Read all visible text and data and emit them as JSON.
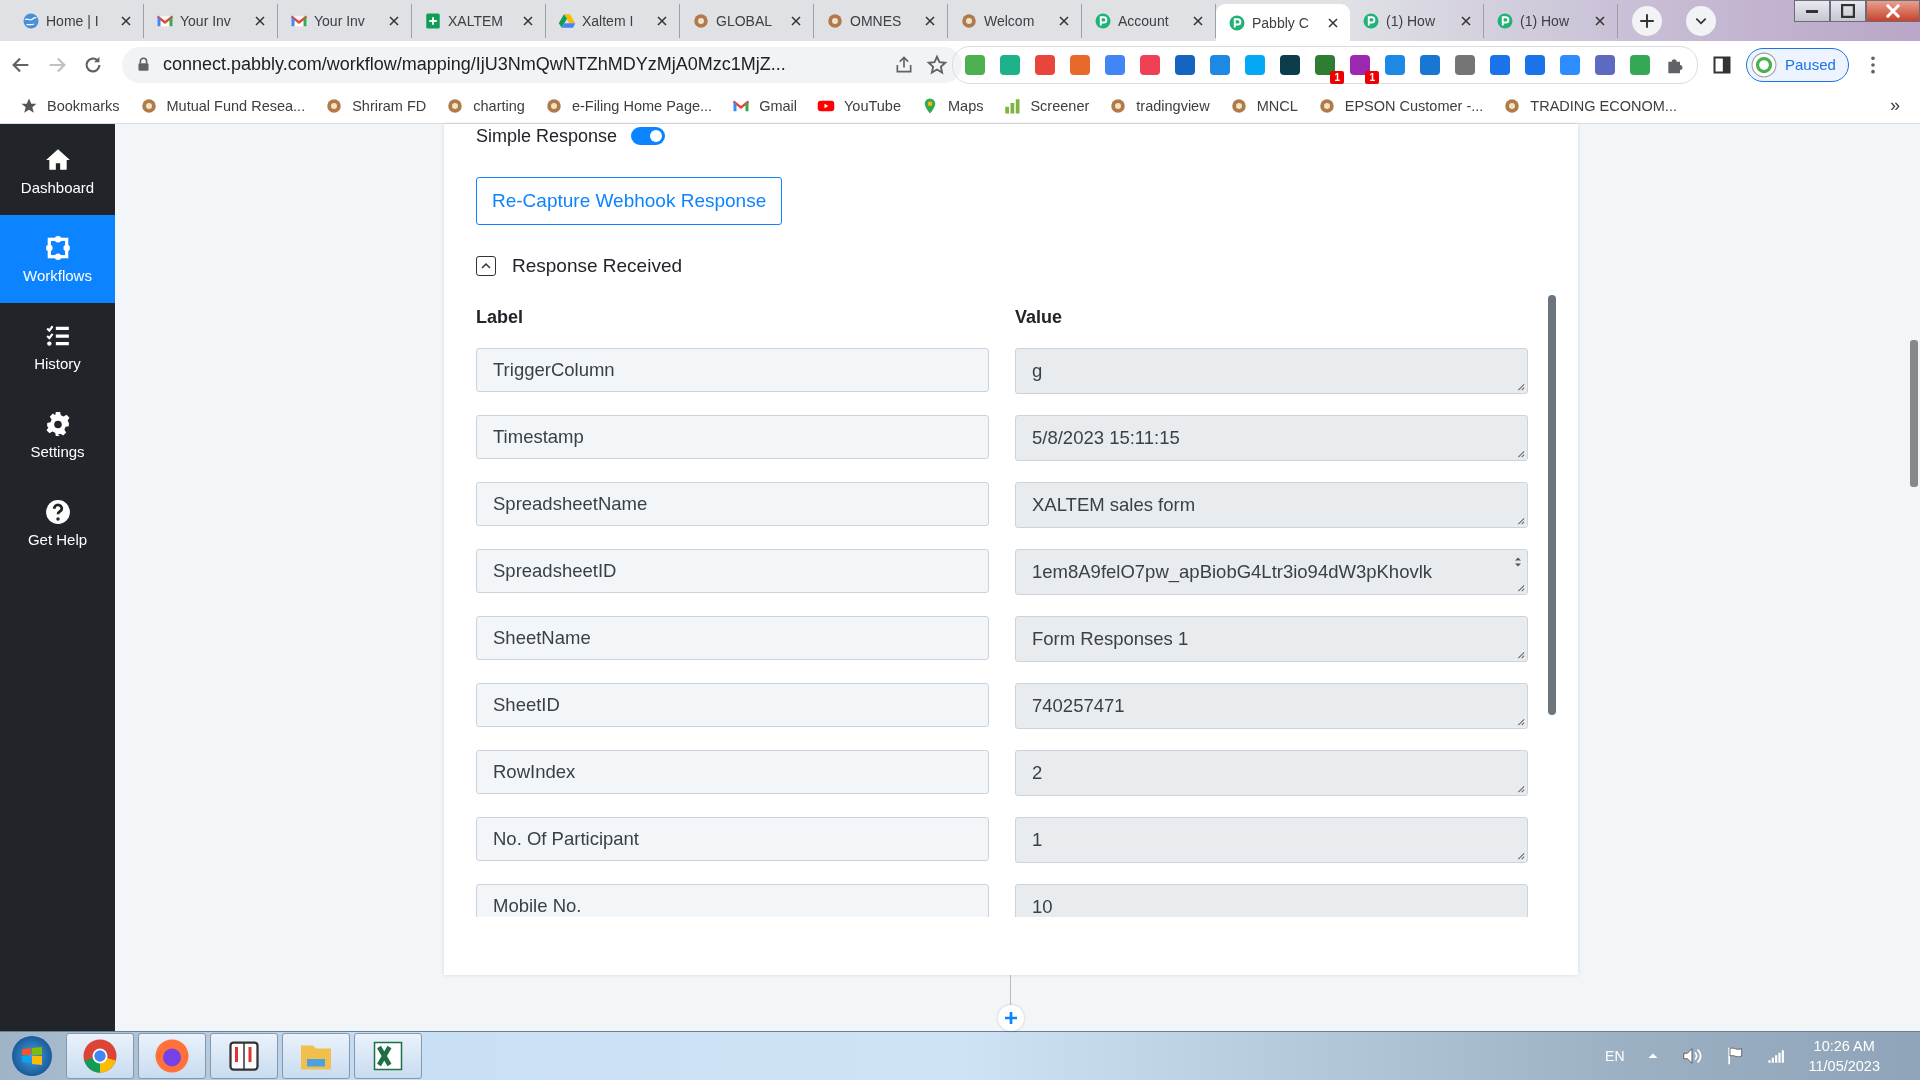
{
  "browser": {
    "tabs": [
      {
        "title": "Home | I",
        "selected": false
      },
      {
        "title": "Your Inv",
        "selected": false
      },
      {
        "title": "Your Inv",
        "selected": false
      },
      {
        "title": "XALTEM",
        "selected": false
      },
      {
        "title": "Xaltem I",
        "selected": false
      },
      {
        "title": "GLOBAL",
        "selected": false
      },
      {
        "title": "OMNES",
        "selected": false
      },
      {
        "title": "Welcom",
        "selected": false
      },
      {
        "title": "Account",
        "selected": false
      },
      {
        "title": "Pabbly C",
        "selected": true
      },
      {
        "title": "(1) How",
        "selected": false
      },
      {
        "title": "(1) How",
        "selected": false
      }
    ],
    "url": "connect.pabbly.com/workflow/mapping/IjU3NmQwNTZhMDYzMjA0Mzc1MjZ...",
    "extensions": [
      {
        "color": "#4caf50"
      },
      {
        "color": "#1fb18a"
      },
      {
        "color": "#e8453c"
      },
      {
        "color": "#e86a2a"
      },
      {
        "color": "#4285f4"
      },
      {
        "color": "#ef4056"
      },
      {
        "color": "#1565c0"
      },
      {
        "color": "#1e88e5"
      },
      {
        "color": "#03a9f4"
      },
      {
        "color": "#0b3d4c"
      },
      {
        "color": "#2e7d32",
        "badge": "1"
      },
      {
        "color": "#9c27b0",
        "badge": "1"
      },
      {
        "color": "#1e88e5"
      },
      {
        "color": "#1976d2"
      },
      {
        "color": "#757575"
      },
      {
        "color": "#1a73e8"
      },
      {
        "color": "#1a73e8"
      },
      {
        "color": "#2d8cff"
      },
      {
        "color": "#5c6bc0"
      },
      {
        "color": "#34a853"
      }
    ],
    "profile": "Paused",
    "bookmarks": [
      "Bookmarks",
      "Mutual Fund Resea...",
      "Shriram FD",
      "charting",
      "e-Filing Home Page...",
      "Gmail",
      "YouTube",
      "Maps",
      "Screener",
      "tradingview",
      "MNCL",
      "EPSON Customer -...",
      "TRADING ECONOM..."
    ],
    "more": "»"
  },
  "sidebar": [
    {
      "label": "Dashboard",
      "selected": false
    },
    {
      "label": "Workflows",
      "selected": true
    },
    {
      "label": "History",
      "selected": false
    },
    {
      "label": "Settings",
      "selected": false
    },
    {
      "label": "Get Help",
      "selected": false
    }
  ],
  "card": {
    "simple_response": {
      "label": "Simple Response",
      "on": true
    },
    "button": "Re-Capture Webhook Response",
    "section": {
      "title": "Response Received",
      "expanded": true
    },
    "columns": [
      "Label",
      "Value"
    ],
    "rows": [
      {
        "label": "TriggerColumn",
        "value": "g"
      },
      {
        "label": "Timestamp",
        "value": "5/8/2023 15:11:15"
      },
      {
        "label": "SpreadsheetName",
        "value": "XALTEM sales form"
      },
      {
        "label": "SpreadsheetID",
        "value": "1em8A9felO7pw_apBiobG4Ltr3io94dW3pKhovlk",
        "overflow": true
      },
      {
        "label": "SheetName",
        "value": "Form Responses 1"
      },
      {
        "label": "SheetID",
        "value": "740257471"
      },
      {
        "label": "RowIndex",
        "value": "2"
      },
      {
        "label": "No. Of Participant",
        "value": "1"
      },
      {
        "label": "Mobile No.",
        "value": "10"
      }
    ]
  },
  "taskbar": {
    "language": "EN",
    "time": "10:26 AM",
    "date": "11/05/2023"
  }
}
